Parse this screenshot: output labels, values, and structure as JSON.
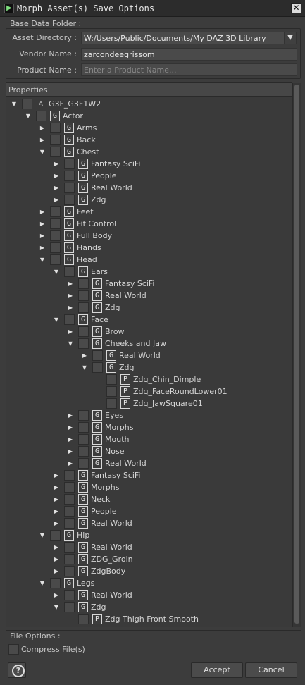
{
  "window": {
    "title": "Morph Asset(s) Save Options",
    "close_glyph": "✕"
  },
  "base": {
    "section_label": "Base Data Folder :",
    "asset_dir_label": "Asset Directory :",
    "asset_dir_value": "W:/Users/Public/Documents/My DAZ 3D Library",
    "vendor_label": "Vendor Name :",
    "vendor_value": "zarcondeegrissom",
    "product_label": "Product Name :",
    "product_placeholder": "Enter a Product Name..."
  },
  "properties": {
    "header": "Properties",
    "rows": [
      {
        "label": "G3F_G3F1W2",
        "depth": 0,
        "arrow": "▼",
        "icon": "figure"
      },
      {
        "label": "Actor",
        "depth": 1,
        "arrow": "▼",
        "icon": "G"
      },
      {
        "label": "Arms",
        "depth": 2,
        "arrow": "▶",
        "icon": "G"
      },
      {
        "label": "Back",
        "depth": 2,
        "arrow": "▶",
        "icon": "G"
      },
      {
        "label": "Chest",
        "depth": 2,
        "arrow": "▼",
        "icon": "G"
      },
      {
        "label": "Fantasy SciFi",
        "depth": 3,
        "arrow": "▶",
        "icon": "G"
      },
      {
        "label": "People",
        "depth": 3,
        "arrow": "▶",
        "icon": "G"
      },
      {
        "label": "Real World",
        "depth": 3,
        "arrow": "▶",
        "icon": "G"
      },
      {
        "label": "Zdg",
        "depth": 3,
        "arrow": "▶",
        "icon": "G"
      },
      {
        "label": "Feet",
        "depth": 2,
        "arrow": "▶",
        "icon": "G"
      },
      {
        "label": "Fit Control",
        "depth": 2,
        "arrow": "▶",
        "icon": "G"
      },
      {
        "label": "Full Body",
        "depth": 2,
        "arrow": "▶",
        "icon": "G"
      },
      {
        "label": "Hands",
        "depth": 2,
        "arrow": "▶",
        "icon": "G"
      },
      {
        "label": "Head",
        "depth": 2,
        "arrow": "▼",
        "icon": "G"
      },
      {
        "label": "Ears",
        "depth": 3,
        "arrow": "▼",
        "icon": "G"
      },
      {
        "label": "Fantasy SciFi",
        "depth": 4,
        "arrow": "▶",
        "icon": "G"
      },
      {
        "label": "Real World",
        "depth": 4,
        "arrow": "▶",
        "icon": "G"
      },
      {
        "label": "Zdg",
        "depth": 4,
        "arrow": "▶",
        "icon": "G"
      },
      {
        "label": "Face",
        "depth": 3,
        "arrow": "▼",
        "icon": "G"
      },
      {
        "label": "Brow",
        "depth": 4,
        "arrow": "▶",
        "icon": "G"
      },
      {
        "label": "Cheeks and Jaw",
        "depth": 4,
        "arrow": "▼",
        "icon": "G"
      },
      {
        "label": "Real World",
        "depth": 5,
        "arrow": "▶",
        "icon": "G"
      },
      {
        "label": "Zdg",
        "depth": 5,
        "arrow": "▼",
        "icon": "G"
      },
      {
        "label": "Zdg_Chin_Dimple",
        "depth": 6,
        "arrow": "",
        "icon": "P"
      },
      {
        "label": "Zdg_FaceRoundLower01",
        "depth": 6,
        "arrow": "",
        "icon": "P"
      },
      {
        "label": "Zdg_JawSquare01",
        "depth": 6,
        "arrow": "",
        "icon": "P"
      },
      {
        "label": "Eyes",
        "depth": 4,
        "arrow": "▶",
        "icon": "G"
      },
      {
        "label": "Morphs",
        "depth": 4,
        "arrow": "▶",
        "icon": "G"
      },
      {
        "label": "Mouth",
        "depth": 4,
        "arrow": "▶",
        "icon": "G"
      },
      {
        "label": "Nose",
        "depth": 4,
        "arrow": "▶",
        "icon": "G"
      },
      {
        "label": "Real World",
        "depth": 4,
        "arrow": "▶",
        "icon": "G"
      },
      {
        "label": "Fantasy SciFi",
        "depth": 3,
        "arrow": "▶",
        "icon": "G"
      },
      {
        "label": "Morphs",
        "depth": 3,
        "arrow": "▶",
        "icon": "G"
      },
      {
        "label": "Neck",
        "depth": 3,
        "arrow": "▶",
        "icon": "G"
      },
      {
        "label": "People",
        "depth": 3,
        "arrow": "▶",
        "icon": "G"
      },
      {
        "label": "Real World",
        "depth": 3,
        "arrow": "▶",
        "icon": "G"
      },
      {
        "label": "Hip",
        "depth": 2,
        "arrow": "▼",
        "icon": "G"
      },
      {
        "label": "Real World",
        "depth": 3,
        "arrow": "▶",
        "icon": "G"
      },
      {
        "label": "ZDG_Groin",
        "depth": 3,
        "arrow": "▶",
        "icon": "G"
      },
      {
        "label": "ZdgBody",
        "depth": 3,
        "arrow": "▶",
        "icon": "G"
      },
      {
        "label": "Legs",
        "depth": 2,
        "arrow": "▼",
        "icon": "G"
      },
      {
        "label": "Real World",
        "depth": 3,
        "arrow": "▶",
        "icon": "G"
      },
      {
        "label": "Zdg",
        "depth": 3,
        "arrow": "▼",
        "icon": "G"
      },
      {
        "label": "Zdg Thigh Front Smooth",
        "depth": 4,
        "arrow": "",
        "icon": "P"
      }
    ]
  },
  "file_options": {
    "section_label": "File Options :",
    "compress_label": "Compress File(s)"
  },
  "buttons": {
    "help_glyph": "?",
    "accept": "Accept",
    "cancel": "Cancel"
  }
}
